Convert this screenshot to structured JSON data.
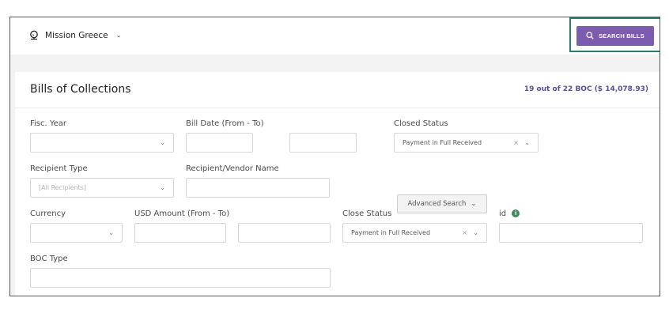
{
  "header": {
    "org_name": "Mission Greece",
    "org_chevron": "⌄",
    "search_button_label": "SEARCH BILLS"
  },
  "card": {
    "title": "Bills of Collections",
    "count": "19 out of 22 BOC ($ 14,078.93)"
  },
  "form": {
    "fisc_year": {
      "label": "Fisc. Year",
      "value": ""
    },
    "bill_date": {
      "label": "Bill Date (From - To)",
      "from": "",
      "to": ""
    },
    "closed_status": {
      "label": "Closed Status",
      "value": "Payment in Full Received"
    },
    "recipient_type": {
      "label": "Recipient Type",
      "placeholder": "[All Recipients]"
    },
    "recipient_name": {
      "label": "Recipient/Vendor Name",
      "value": ""
    },
    "advanced_search_label": "Advanced Search",
    "currency": {
      "label": "Currency",
      "value": ""
    },
    "usd_amount": {
      "label": "USD Amount (From - To)",
      "from": "",
      "to": ""
    },
    "close_status": {
      "label": "Close Status",
      "value": "Payment in Full Received"
    },
    "id_field": {
      "label": "id",
      "value": ""
    },
    "boc_type": {
      "label": "BOC Type",
      "value": ""
    }
  },
  "icons": {
    "org": "globe-icon",
    "search": "search-icon",
    "info": "info-icon",
    "caret": "chevron-down-icon",
    "clear": "clear-icon"
  },
  "colors": {
    "accent": "#7c5cae",
    "count_text": "#5d4a9a",
    "highlight_border": "#2f7d72",
    "info_icon": "#3c8a5e"
  }
}
